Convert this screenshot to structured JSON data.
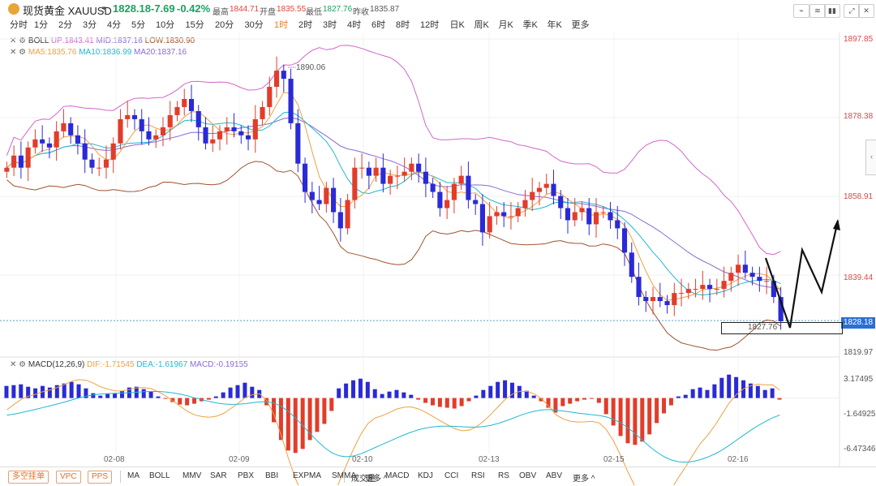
{
  "header": {
    "symbol": "现货黄金 XAUUSD",
    "price": "1828.18",
    "change": "-7.69",
    "change_pct": "-0.42%",
    "high_label": "最高",
    "high": "1844.71",
    "open_label": "开盘",
    "open": "1835.55",
    "low_label": "最低",
    "low": "1827.76",
    "prev_label": "昨收",
    "prev": "1835.87"
  },
  "periods": [
    "分时",
    "1分",
    "2分",
    "3分",
    "4分",
    "5分",
    "10分",
    "15分",
    "20分",
    "30分",
    "1时",
    "2时",
    "3时",
    "4时",
    "6时",
    "8时",
    "12时",
    "日K",
    "周K",
    "月K",
    "季K",
    "年K",
    "更多"
  ],
  "active_period": "1时",
  "boll": {
    "name": "BOLL",
    "up": "UP:1843.41",
    "mid": "MID:1837.16",
    "low": "LOW:1830.90"
  },
  "ma": {
    "ma5": "MA5:1835.76",
    "ma10": "MA10:1836.99",
    "ma20": "MA20:1837.16"
  },
  "macd": {
    "name": "MACD(12,26,9)",
    "dif": "DIF:-1.71545",
    "dea": "DEA:-1.61967",
    "macd": "MACD:-0.19155"
  },
  "price_axis": [
    "1897.85",
    "1878.38",
    "1858.91",
    "1839.44",
    "1819.97"
  ],
  "current_price_tag": "1828.18",
  "annot_high": "1890.06",
  "annot_low": "1827.76",
  "macd_axis": [
    "3.17495",
    "-1.64925",
    "-6.47346"
  ],
  "dates": [
    "02-08",
    "02-09",
    "02-10",
    "02-13",
    "02-15",
    "02-16"
  ],
  "bottom": {
    "pills": [
      "多空挂单",
      "VPC",
      "PPS"
    ],
    "group1": [
      "MA",
      "BOLL",
      "MMV",
      "SAR",
      "PBX",
      "BBI",
      "EXPMA",
      "SMMA",
      "更多 ^"
    ],
    "group2": [
      "成交量",
      "MACD",
      "KDJ",
      "CCI",
      "RSI",
      "RS",
      "OBV",
      "ABV",
      "更多 ^"
    ]
  },
  "colors": {
    "up": "#e23c2a",
    "down": "#2a2ad6",
    "boll_up": "#d466c8",
    "boll_low": "#a0522d",
    "ma5": "#f0a040",
    "ma10": "#20b8d0",
    "ma20": "#8a6ad8"
  },
  "chart_data": {
    "type": "candlestick",
    "title": "",
    "price_ylim": [
      1819.97,
      1897.85
    ],
    "series_close": [
      1866,
      1869,
      1866,
      1871,
      1873,
      1872,
      1871,
      1875,
      1877,
      1874,
      1872,
      1868,
      1866,
      1866,
      1868,
      1872,
      1878,
      1879,
      1878,
      1875,
      1873,
      1874,
      1876,
      1879,
      1881,
      1883,
      1880,
      1876,
      1872,
      1873,
      1875,
      1876,
      1875,
      1874,
      1873,
      1878,
      1881,
      1886,
      1890,
      1888,
      1877,
      1867,
      1860,
      1858,
      1857,
      1861,
      1855,
      1851,
      1858,
      1866,
      1866,
      1864,
      1866,
      1862,
      1864,
      1864,
      1865,
      1867,
      1865,
      1862,
      1860,
      1856,
      1858,
      1862,
      1864,
      1858,
      1857,
      1850,
      1854,
      1855,
      1854,
      1854,
      1856,
      1858,
      1860,
      1861,
      1862,
      1859,
      1856,
      1853,
      1855,
      1856,
      1852,
      1855,
      1855,
      1853,
      1851,
      1845,
      1839,
      1834,
      1833,
      1834,
      1833,
      1832,
      1835,
      1835,
      1836,
      1836,
      1837,
      1836,
      1836,
      1838,
      1840,
      1842,
      1840,
      1839,
      1838,
      1838,
      1834,
      1828
    ],
    "macd_hist": [
      1.5,
      1.6,
      1.7,
      1.4,
      1.2,
      1.5,
      1.3,
      1.6,
      1.8,
      2.0,
      1.7,
      1.2,
      0.6,
      0.3,
      0.5,
      0.6,
      0.9,
      1.3,
      1.4,
      1.1,
      0.8,
      0.2,
      -0.1,
      -0.5,
      -0.8,
      -0.9,
      -0.7,
      -0.4,
      -0.2,
      0.2,
      0.7,
      1.3,
      1.6,
      1.9,
      1.4,
      1.0,
      -0.9,
      -3.0,
      -5.2,
      -6.5,
      -6.8,
      -6.3,
      -5.2,
      -4.2,
      -3.2,
      -1.6,
      1.2,
      1.8,
      2.2,
      2.4,
      2.0,
      1.1,
      0.5,
      0.8,
      1.0,
      0.7,
      0.4,
      -0.2,
      -0.6,
      -0.9,
      -1.1,
      -1.2,
      -1.3,
      -1.0,
      -0.4,
      0.3,
      1.0,
      1.5,
      2.0,
      2.2,
      1.9,
      1.5,
      0.9,
      0.3,
      -0.4,
      -1.2,
      -1.8,
      -1.0,
      -0.7,
      -0.4,
      -0.2,
      -0.1,
      -0.6,
      -2.0,
      -3.4,
      -4.7,
      -5.6,
      -5.8,
      -5.4,
      -4.5,
      -3.1,
      -1.9,
      -0.9,
      0.2,
      0.4,
      1.1,
      1.3,
      1.0,
      1.7,
      2.5,
      2.9,
      2.6,
      2.2,
      1.8,
      1.5,
      1.0,
      1.2,
      -0.2
    ],
    "macd_ylim": [
      -6.47346,
      3.17495
    ],
    "x_labels": [
      "02-08",
      "02-09",
      "02-10",
      "02-13",
      "02-15",
      "02-16"
    ]
  }
}
